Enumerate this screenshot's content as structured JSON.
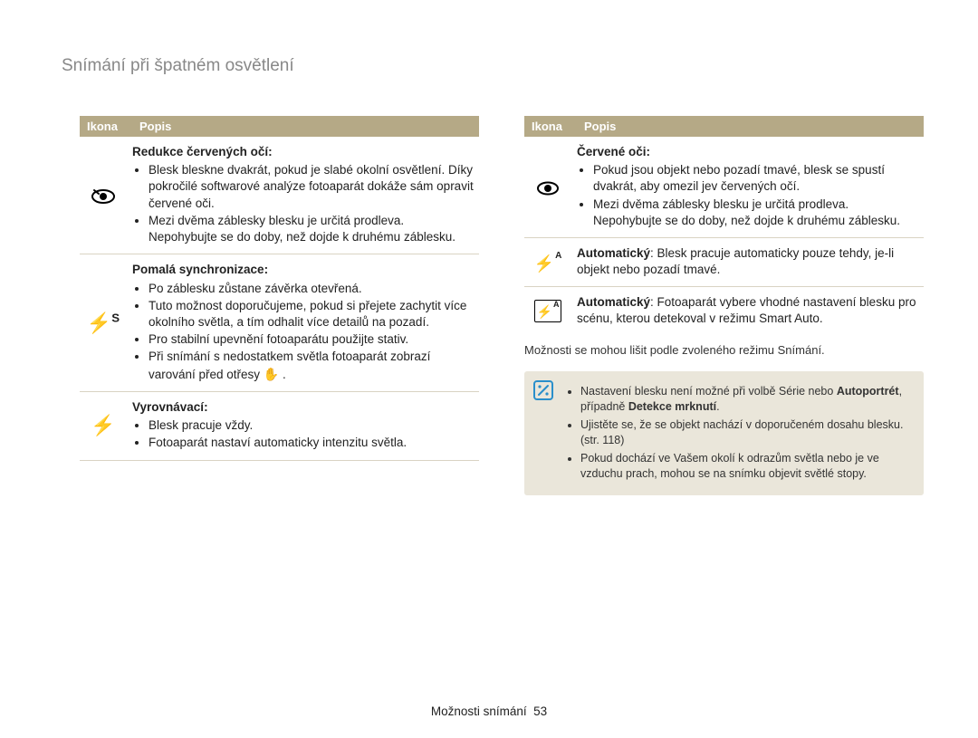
{
  "page_title": "Snímání při špatném osvětlení",
  "table_headers": {
    "icon": "Ikona",
    "desc": "Popis"
  },
  "left_rows": [
    {
      "title": "Redukce červených očí",
      "title_suffix": ":",
      "items": [
        "Blesk bleskne dvakrát, pokud je slabé okolní osvětlení. Díky pokročilé softwarové analýze fotoaparát dokáže sám opravit červené oči.",
        "Mezi dvěma záblesky blesku je určitá prodleva. Nepohybujte se do doby, než dojde k druhému záblesku."
      ]
    },
    {
      "title": "Pomalá synchronizace",
      "title_suffix": ":",
      "items": [
        "Po záblesku zůstane závěrka otevřená.",
        "Tuto možnost doporučujeme, pokud si přejete zachytit více okolního světla, a tím odhalit více detailů na pozadí.",
        "Pro stabilní upevnění fotoaparátu použijte stativ.",
        "Při snímání s nedostatkem světla fotoaparát zobrazí varování před otřesy "
      ],
      "hand_after_last": true
    },
    {
      "title": "Vyrovnávací",
      "title_suffix": ":",
      "items": [
        "Blesk pracuje vždy.",
        "Fotoaparát nastaví automaticky intenzitu světla."
      ]
    }
  ],
  "right_rows": [
    {
      "title": "Červené oči",
      "title_suffix": ":",
      "items": [
        "Pokud jsou objekt nebo pozadí tmavé, blesk se spustí dvakrát, aby omezil jev červených očí.",
        "Mezi dvěma záblesky blesku je určitá prodleva. Nepohybujte se do doby, než dojde k druhému záblesku."
      ]
    },
    {
      "inline_title": "Automatický",
      "inline_text": ": Blesk pracuje automaticky pouze tehdy, je-li objekt nebo pozadí tmavé."
    },
    {
      "inline_title": "Automatický",
      "inline_text": ": Fotoaparát vybere vhodné nastavení blesku pro scénu, kterou detekoval v režimu Smart Auto."
    }
  ],
  "note_line": "Možnosti se mohou lišit podle zvoleného režimu Snímání.",
  "note_box": {
    "items": [
      {
        "pre": "Nastavení blesku není možné při volbě Série nebo ",
        "b1": "Autoportrét",
        "mid": ", případně ",
        "b2": "Detekce mrknutí",
        "post": "."
      },
      {
        "text": "Ujistěte se, že se objekt nachází v doporučeném dosahu blesku. (str. 118)"
      },
      {
        "text": "Pokud dochází ve Vašem okolí k odrazům světla nebo je ve vzduchu prach, mohou se na snímku objevit světlé stopy."
      }
    ]
  },
  "footer": {
    "label": "Možnosti snímání",
    "page": "53"
  }
}
